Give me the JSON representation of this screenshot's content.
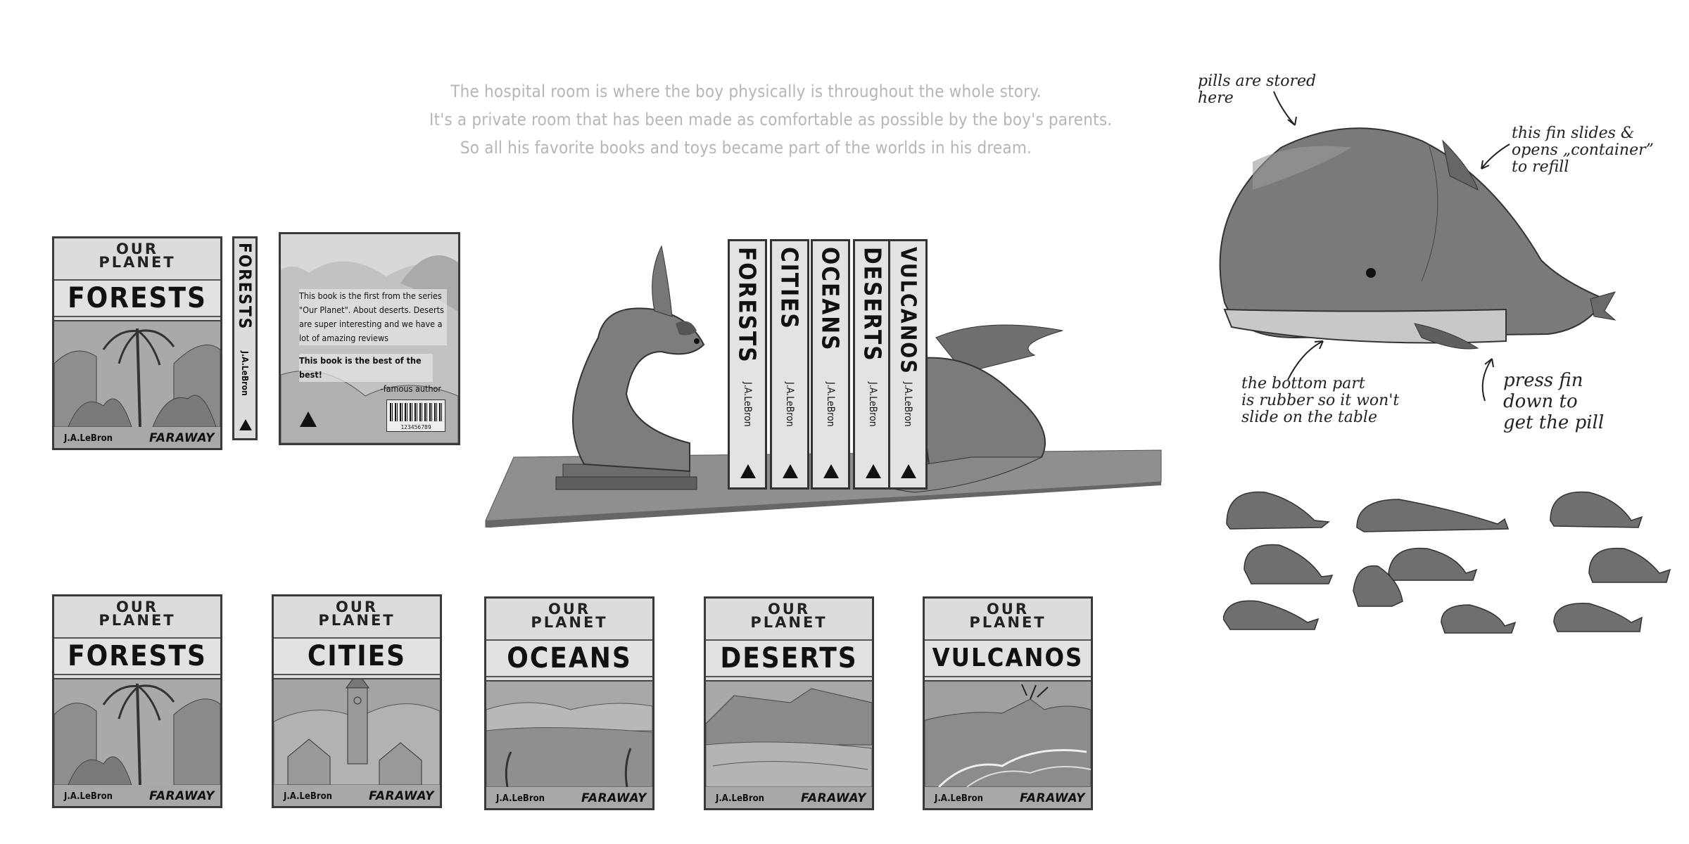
{
  "intro": {
    "line1": "The hospital room is where the boy physically is throughout the whole story.",
    "line2": "It's a private room that has been made as comfortable as possible by the boy's parents.",
    "line3": "So all his favorite books and toys became part of the worlds in his dream."
  },
  "series": "OUR\nPLANET",
  "author": "J.A.LeBron",
  "publisher": "FARAWAY",
  "front_cover": {
    "title": "FORESTS"
  },
  "spine": {
    "title": "FORESTS",
    "author": "J.A.LeBron"
  },
  "back_cover": {
    "blurb": "This book is the first from the series \"Our Planet\". About deserts. Deserts are super interesting and we have a lot of amazing reviews",
    "quote": "This book is the best of the best!",
    "quote_source": "-famous author",
    "barcode_number": "123456789"
  },
  "shelf_books": [
    {
      "title": "FORESTS",
      "author": "J.A.LeBron"
    },
    {
      "title": "CITIES",
      "author": "J.A.LeBron"
    },
    {
      "title": "OCEANS",
      "author": "J.A.LeBron"
    },
    {
      "title": "DESERTS",
      "author": "J.A.LeBron"
    },
    {
      "title": "VULCANOS",
      "author": "J.A.LeBron"
    }
  ],
  "covers": [
    {
      "title": "FORESTS"
    },
    {
      "title": "CITIES"
    },
    {
      "title": "OCEANS"
    },
    {
      "title": "DESERTS"
    },
    {
      "title": "VULCANOS"
    }
  ],
  "whale_notes": {
    "pills": "pills are stored\n here",
    "fin": "this fin slides &\nopens „container”\nto refill",
    "bottom": "the bottom part\nis rubber so it won't\nslide on the table",
    "press": "press fin\ndown to\nget the pill"
  }
}
